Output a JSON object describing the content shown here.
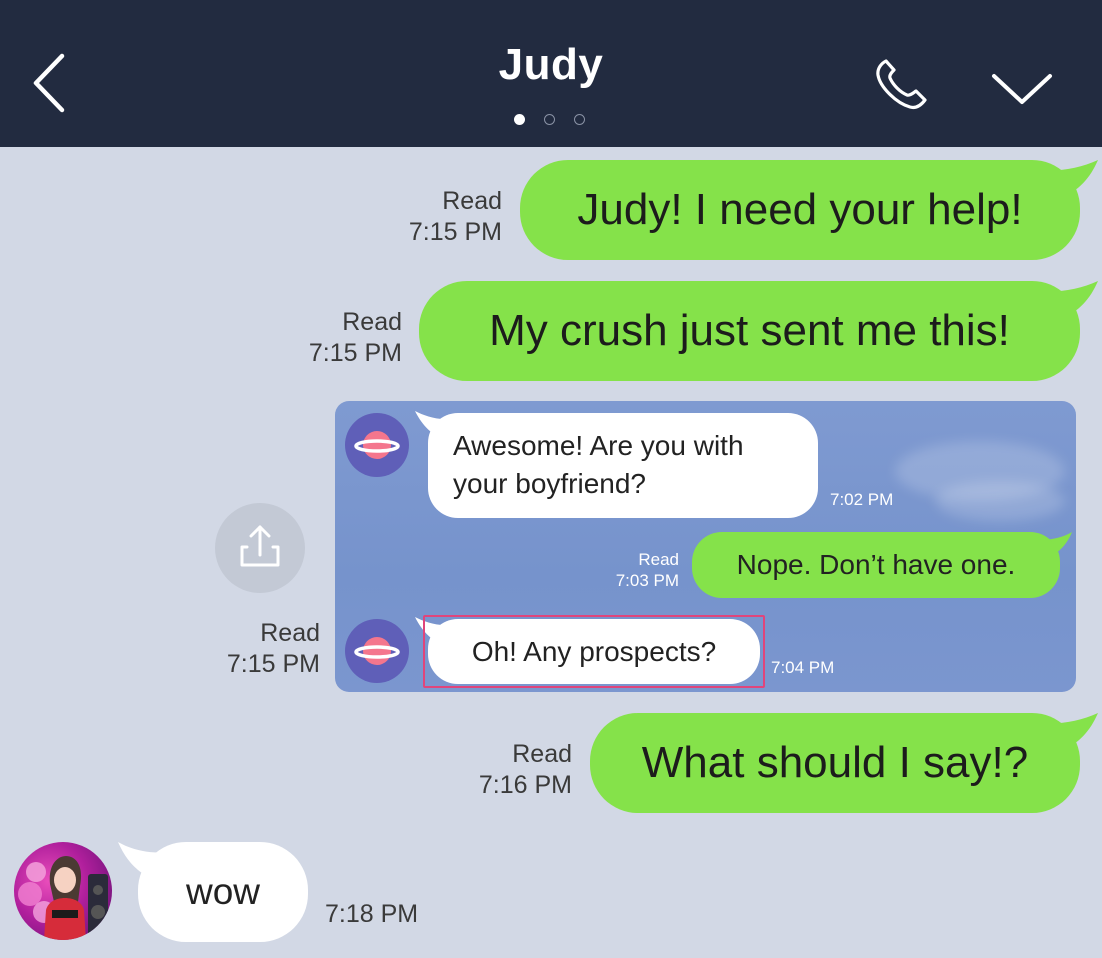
{
  "header": {
    "title": "Judy",
    "page_dots": {
      "count": 3,
      "active_index": 0
    },
    "icons": [
      "back-arrow-icon",
      "phone-icon",
      "chevron-down-icon"
    ]
  },
  "messages": [
    {
      "direction": "outgoing",
      "text": "Judy! I need your help!",
      "status": "Read",
      "time": "7:15 PM"
    },
    {
      "direction": "outgoing",
      "text": "My crush just sent me this!",
      "status": "Read",
      "time": "7:15 PM"
    },
    {
      "direction": "outgoing",
      "type": "image",
      "status": "Read",
      "time": "7:15 PM"
    },
    {
      "direction": "outgoing",
      "text": "What should I say!?",
      "status": "Read",
      "time": "7:16 PM"
    },
    {
      "direction": "incoming",
      "text": "wow",
      "time": "7:18 PM"
    }
  ],
  "embedded_screenshot": {
    "messages": [
      {
        "direction": "incoming",
        "lines": [
          "Awesome! Are you with",
          "your boyfriend?"
        ],
        "time": "7:02 PM"
      },
      {
        "direction": "outgoing",
        "text": "Nope. Don’t have one.",
        "status": "Read",
        "time": "7:03 PM"
      },
      {
        "direction": "incoming",
        "text": "Oh! Any prospects?",
        "time": "7:04 PM",
        "highlighted": true
      }
    ]
  },
  "colors": {
    "header_bg": "#222b40",
    "chat_bg": "#d2d8e5",
    "outgoing_bubble": "#85e24a",
    "incoming_bubble": "#ffffff",
    "highlight_border": "#e0457b"
  }
}
